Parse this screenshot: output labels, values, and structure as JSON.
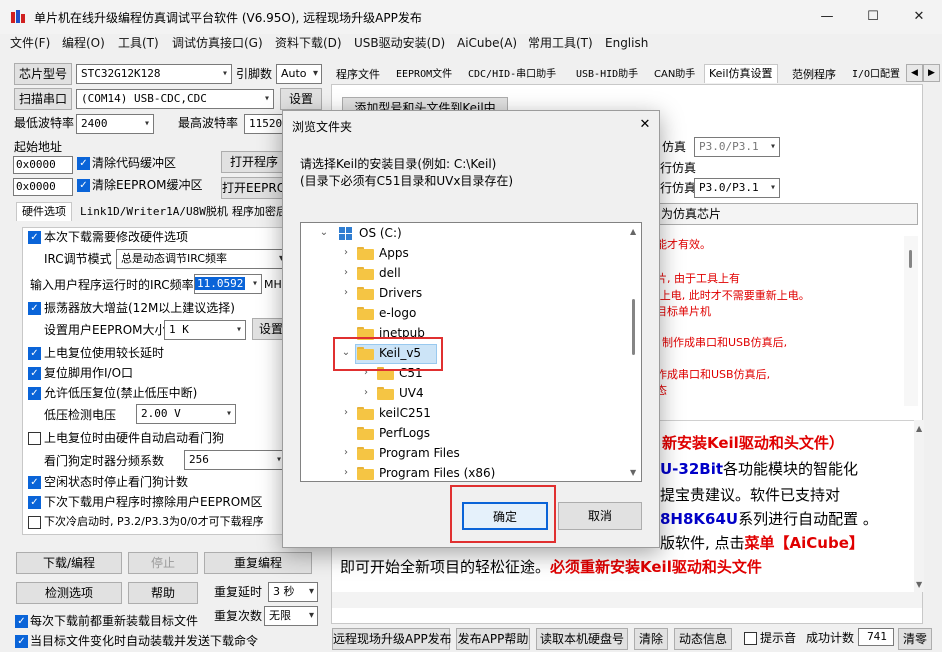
{
  "window": {
    "title": "单片机在线升级编程仿真调试平台软件 (V6.95O), 远程现场升级APP发布"
  },
  "menu": [
    "文件(F)",
    "编程(O)",
    "工具(T)",
    "调试仿真接口(G)",
    "资料下载(D)",
    "USB驱动安装(D)",
    "AiCube(A)",
    "常用工具(T)",
    "English"
  ],
  "left": {
    "chip_label": "芯片型号",
    "chip_value": "STC32G12K128",
    "pin_label": "引脚数",
    "pin_value": "Auto",
    "scan_label": "扫描串口",
    "port_value": "(COM14) USB-CDC,CDC",
    "settings_label": "设置",
    "min_baud_label": "最低波特率",
    "min_baud_value": "2400",
    "max_baud_label": "最高波特率",
    "max_baud_value": "115200",
    "start_addr_label": "起始地址",
    "addr1": "0x0000",
    "clear_code_label": "清除代码缓冲区",
    "open_prog_label": "打开程序",
    "addr2": "0x0000",
    "clear_eeprom_label": "清除EEPROM缓冲区",
    "open_eeprom_label": "打开EEPRO",
    "tabs": [
      "硬件选项",
      "Link1D/Writer1A/U8W脱机",
      "程序加密后"
    ],
    "options": {
      "modify_hw": "本次下载需要修改硬件选项",
      "irc_mode_label": "IRC调节模式",
      "irc_mode_value": "总是动态调节IRC频率",
      "irc_freq_label": "输入用户程序运行时的IRC频率",
      "irc_freq_value": "11.0592",
      "irc_unit": "MHz",
      "osc_gain": "振荡器放大增益(12M以上建议选择)",
      "eeprom_size_label": "设置用户EEPROM大小",
      "eeprom_size_value": "1   K",
      "eeprom_set": "设置",
      "power_delay": "上电复位使用较长延时",
      "reset_io": "复位脚用作I/O口",
      "lvd_reset": "允许低压复位(禁止低压中断)",
      "lvd_label": "低压检测电压",
      "lvd_value": "2.00 V",
      "wdt_auto": "上电复位时由硬件自动启动看门狗",
      "wdt_div_label": "看门狗定时器分频系数",
      "wdt_div_value": "256",
      "idle_wdt": "空闲状态时停止看门狗计数",
      "erase_eeprom": "下次下载用户程序时擦除用户EEPROM区",
      "cold_boot": "下次冷启动时, P3.2/P3.3为0/0才可下载程序"
    },
    "download_label": "下载/编程",
    "stop_label": "停止",
    "reprogram_label": "重复编程",
    "check_label": "检测选项",
    "help_label": "帮助",
    "repeat_delay_label": "重复延时",
    "repeat_delay_value": "3 秒",
    "repeat_count_label": "重复次数",
    "repeat_count_value": "无限",
    "reload_each": "每次下载前都重新装载目标文件",
    "auto_send": "当目标文件变化时自动装载并发送下载命令"
  },
  "right": {
    "tabs": [
      "程序文件",
      "EEPROM文件",
      "CDC/HID-串口助手",
      "USB-HID助手",
      "CAN助手",
      "Keil仿真设置",
      "范例程序",
      "I/O口配置"
    ],
    "add_keil_btn": "添加型号和头文件到Keil中",
    "sim_label1": "仿真",
    "sim_value1": "P3.0/P3.1",
    "sim_label2": "行仿真",
    "sim_label3": "行仿真",
    "sim_value3": "P3.0/P3.1",
    "make_chip_btn": "为仿真芯片",
    "notes": [
      "能才有效。",
      "片, 由于工具上有",
      "/上电, 此时才不需要重新上电。",
      "目标单片机",
      "制作成串口和USB仿真后,",
      "作成串口和USB仿真后,",
      "态"
    ],
    "big1": "新安装Keil驱动和头文件）",
    "big2a": "U-32Bit",
    "big2b": "各功能模块的智能化",
    "big3": "提宝贵建议。软件已支持对",
    "big4a": "8H8K64U",
    "big4b": "系列进行自动配置 。",
    "big5a": "版软件, 点击",
    "big5b": "菜单【AiCube】",
    "big6a": "即可开始全新项目的轻松征途。",
    "big6b": "必须重新安装Keil驱动和头文件"
  },
  "bottom": {
    "publish_label": "远程现场升级APP发布",
    "publish_help": "发布APP帮助",
    "read_disk": "读取本机硬盘号",
    "clear": "清除",
    "dynamic": "动态信息",
    "beep": "提示音",
    "success_label": "成功计数",
    "success_value": "741",
    "clear_count": "清零"
  },
  "dialog": {
    "title": "浏览文件夹",
    "line1": "请选择Keil的安装目录(例如: C:\\Keil)",
    "line2": "(目录下必须有C51目录和UVx目录存在)",
    "tree": [
      {
        "label": "OS (C:)"
      },
      {
        "label": "Apps"
      },
      {
        "label": "dell"
      },
      {
        "label": "Drivers"
      },
      {
        "label": "e-logo"
      },
      {
        "label": "inetpub"
      },
      {
        "label": "Keil_v5"
      },
      {
        "label": "C51"
      },
      {
        "label": "UV4"
      },
      {
        "label": "keilC251"
      },
      {
        "label": "PerfLogs"
      },
      {
        "label": "Program Files"
      },
      {
        "label": "Program Files (x86)"
      }
    ],
    "ok_label": "确定",
    "cancel_label": "取消",
    "close_glyph": "✕"
  }
}
